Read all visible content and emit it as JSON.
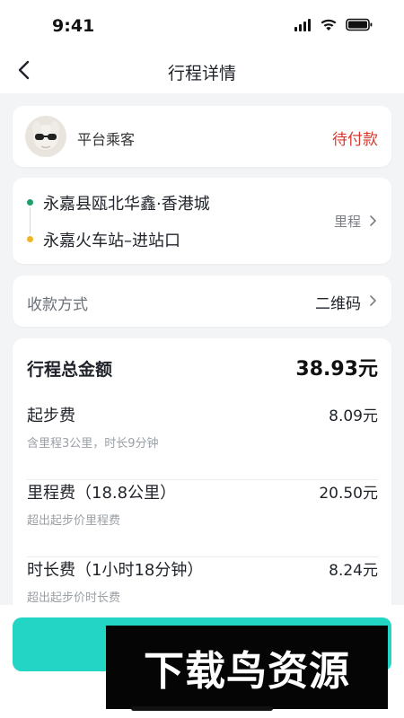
{
  "status_bar": {
    "time": "9:41"
  },
  "header": {
    "title": "行程详情"
  },
  "passenger": {
    "label": "平台乘客",
    "status": "待付款"
  },
  "route": {
    "start": "永嘉县瓯北华鑫·香港城",
    "end": "永嘉火车站–进站口",
    "mileage_link": "里程"
  },
  "payment": {
    "label": "收款方式",
    "value": "二维码"
  },
  "fare": {
    "total_label": "行程总金额",
    "total_amount": "38.93元",
    "items": [
      {
        "name": "起步费",
        "amount": "8.09元",
        "desc": "含里程3公里，时长9分钟"
      },
      {
        "name": "里程费（18.8公里）",
        "amount": "20.50元",
        "desc": "超出起步价里程费"
      },
      {
        "name": "时长费（1小时18分钟）",
        "amount": "8.24元",
        "desc": "超出起步价时长费"
      }
    ]
  },
  "watermark": {
    "text": "下载鸟资源"
  },
  "colors": {
    "status_pending": "#d63a2f",
    "button": "#23d5c4",
    "start_dot": "#1f9f68",
    "end_dot": "#f0b325"
  },
  "icons": [
    "back-icon",
    "chevron-right-icon",
    "signal-icon",
    "wifi-icon",
    "battery-icon"
  ]
}
